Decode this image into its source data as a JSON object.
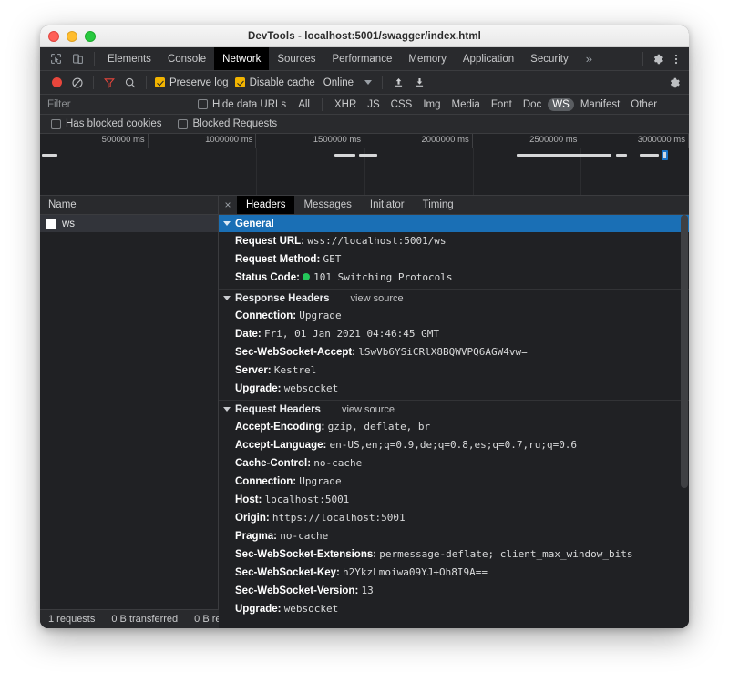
{
  "window": {
    "title": "DevTools - localhost:5001/swagger/index.html",
    "traffic_lights": [
      "close",
      "minimize",
      "maximize"
    ]
  },
  "tabbar": {
    "left_icons": [
      "inspect-element-icon",
      "device-toolbar-icon"
    ],
    "tabs": [
      {
        "label": "Elements",
        "active": false
      },
      {
        "label": "Console",
        "active": false
      },
      {
        "label": "Network",
        "active": true
      },
      {
        "label": "Sources",
        "active": false
      },
      {
        "label": "Performance",
        "active": false
      },
      {
        "label": "Memory",
        "active": false
      },
      {
        "label": "Application",
        "active": false
      },
      {
        "label": "Security",
        "active": false
      }
    ],
    "more_label": "»",
    "right_icons": [
      "settings-gear-icon",
      "more-options-icon"
    ]
  },
  "network_toolbar": {
    "record_label": "record-button",
    "clear_label": "clear-button",
    "filter_label": "filter-button",
    "search_label": "search-button",
    "preserve_log": {
      "label": "Preserve log",
      "checked": true
    },
    "disable_cache": {
      "label": "Disable cache",
      "checked": true
    },
    "throttle": {
      "value": "Online"
    },
    "import_label": "import-har-button",
    "export_label": "export-har-button",
    "settings_label": "network-settings-button"
  },
  "filter_bar": {
    "placeholder": "Filter",
    "value": "",
    "hide_data_urls": {
      "label": "Hide data URLs",
      "checked": false
    },
    "types": [
      {
        "label": "All",
        "active": false
      },
      {
        "label": "XHR",
        "active": false
      },
      {
        "label": "JS",
        "active": false
      },
      {
        "label": "CSS",
        "active": false
      },
      {
        "label": "Img",
        "active": false
      },
      {
        "label": "Media",
        "active": false
      },
      {
        "label": "Font",
        "active": false
      },
      {
        "label": "Doc",
        "active": false
      },
      {
        "label": "WS",
        "active": true
      },
      {
        "label": "Manifest",
        "active": false
      },
      {
        "label": "Other",
        "active": false
      }
    ],
    "has_blocked_cookies": {
      "label": "Has blocked cookies",
      "checked": false
    },
    "blocked_requests": {
      "label": "Blocked Requests",
      "checked": false
    }
  },
  "overview": {
    "ticks": [
      "500000 ms",
      "1000000 ms",
      "1500000 ms",
      "2000000 ms",
      "2500000 ms",
      "3000000 ms"
    ],
    "bars": [
      {
        "left_pct": 0.3,
        "width_pct": 2.3
      },
      {
        "left_pct": 45.4,
        "width_pct": 3.2
      },
      {
        "left_pct": 49.1,
        "width_pct": 2.8
      },
      {
        "left_pct": 73.5,
        "width_pct": 14.6
      },
      {
        "left_pct": 88.8,
        "width_pct": 1.7
      },
      {
        "left_pct": 92.4,
        "width_pct": 2.9
      }
    ],
    "marker_left_pct": 95.8
  },
  "request_list": {
    "column_header": "Name",
    "rows": [
      {
        "name": "ws",
        "icon": "websocket-icon",
        "selected": true
      }
    ]
  },
  "details": {
    "close_label": "×",
    "tabs": [
      {
        "label": "Headers",
        "active": true
      },
      {
        "label": "Messages",
        "active": false
      },
      {
        "label": "Initiator",
        "active": false
      },
      {
        "label": "Timing",
        "active": false
      }
    ],
    "view_source_label": "view source",
    "sections": [
      {
        "title": "General",
        "highlight": true,
        "has_view_source": false,
        "rows": [
          {
            "name": "Request URL:",
            "value": "wss://localhost:5001/ws",
            "status_dot": false
          },
          {
            "name": "Request Method:",
            "value": "GET",
            "status_dot": false
          },
          {
            "name": "Status Code:",
            "value": "101 Switching Protocols",
            "status_dot": true
          }
        ]
      },
      {
        "title": "Response Headers",
        "highlight": false,
        "has_view_source": true,
        "rows": [
          {
            "name": "Connection:",
            "value": "Upgrade",
            "status_dot": false
          },
          {
            "name": "Date:",
            "value": "Fri, 01 Jan 2021 04:46:45 GMT",
            "status_dot": false
          },
          {
            "name": "Sec-WebSocket-Accept:",
            "value": "lSwVb6YSiCRlX8BQWVPQ6AGW4vw=",
            "status_dot": false
          },
          {
            "name": "Server:",
            "value": "Kestrel",
            "status_dot": false
          },
          {
            "name": "Upgrade:",
            "value": "websocket",
            "status_dot": false
          }
        ]
      },
      {
        "title": "Request Headers",
        "highlight": false,
        "has_view_source": true,
        "rows": [
          {
            "name": "Accept-Encoding:",
            "value": "gzip, deflate, br",
            "status_dot": false
          },
          {
            "name": "Accept-Language:",
            "value": "en-US,en;q=0.9,de;q=0.8,es;q=0.7,ru;q=0.6",
            "status_dot": false
          },
          {
            "name": "Cache-Control:",
            "value": "no-cache",
            "status_dot": false
          },
          {
            "name": "Connection:",
            "value": "Upgrade",
            "status_dot": false
          },
          {
            "name": "Host:",
            "value": "localhost:5001",
            "status_dot": false
          },
          {
            "name": "Origin:",
            "value": "https://localhost:5001",
            "status_dot": false
          },
          {
            "name": "Pragma:",
            "value": "no-cache",
            "status_dot": false
          },
          {
            "name": "Sec-WebSocket-Extensions:",
            "value": "permessage-deflate; client_max_window_bits",
            "status_dot": false
          },
          {
            "name": "Sec-WebSocket-Key:",
            "value": "h2YkzLmoiwa09YJ+Oh8I9A==",
            "status_dot": false
          },
          {
            "name": "Sec-WebSocket-Version:",
            "value": "13",
            "status_dot": false
          },
          {
            "name": "Upgrade:",
            "value": "websocket",
            "status_dot": false
          }
        ]
      }
    ]
  },
  "status_bar": {
    "items": [
      "1 requests",
      "0 B transferred",
      "0 B re"
    ]
  },
  "colors": {
    "accent_blue": "#1a6fb5",
    "record_red": "#e8463c",
    "checkbox_yellow": "#f2b400",
    "status_green": "#24c75a",
    "panel_bg": "#202124",
    "toolbar_bg": "#292a2d"
  }
}
